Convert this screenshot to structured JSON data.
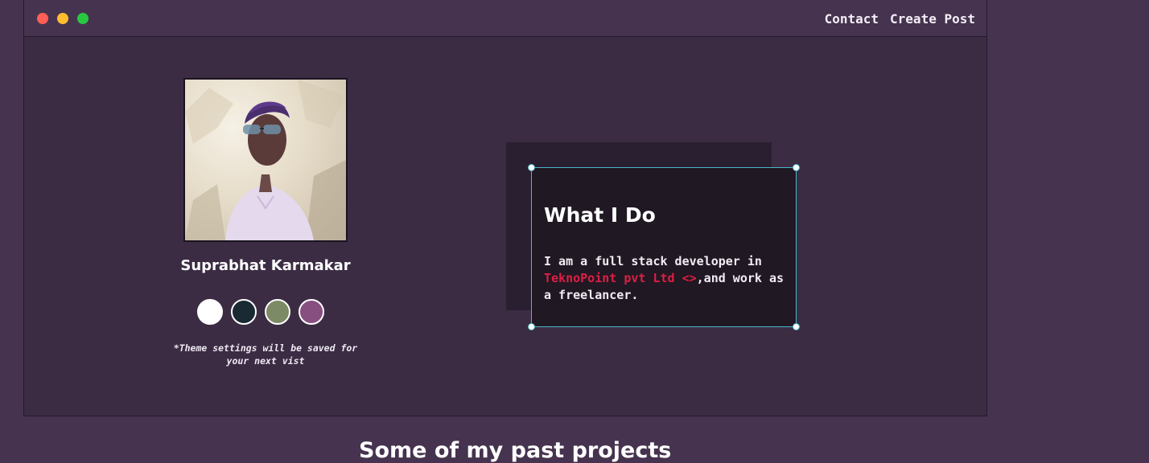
{
  "nav": {
    "contact_label": "Contact",
    "create_post_label": "Create Post"
  },
  "window_controls": {
    "close_color": "#ff5f57",
    "minimize_color": "#febc2e",
    "maximize_color": "#28c840"
  },
  "profile": {
    "name": "Suprabhat Karmakar",
    "avatar_icon": "profile-photo",
    "theme_swatches": [
      {
        "name": "white",
        "color": "#ffffff"
      },
      {
        "name": "dark-navy",
        "color": "#1a2a33"
      },
      {
        "name": "sage-green",
        "color": "#7d8a66"
      },
      {
        "name": "mauve",
        "color": "#874f7f"
      }
    ],
    "theme_note": "*Theme settings will be saved for your next vist"
  },
  "about": {
    "title": "What I Do",
    "text_before": "I am a full stack developer in ",
    "company": "TeknoPoint pvt Ltd <>",
    "text_after": ",and work as a freelancer.",
    "company_color": "#dc1f45"
  },
  "projects": {
    "title": "Some of my past projects"
  }
}
